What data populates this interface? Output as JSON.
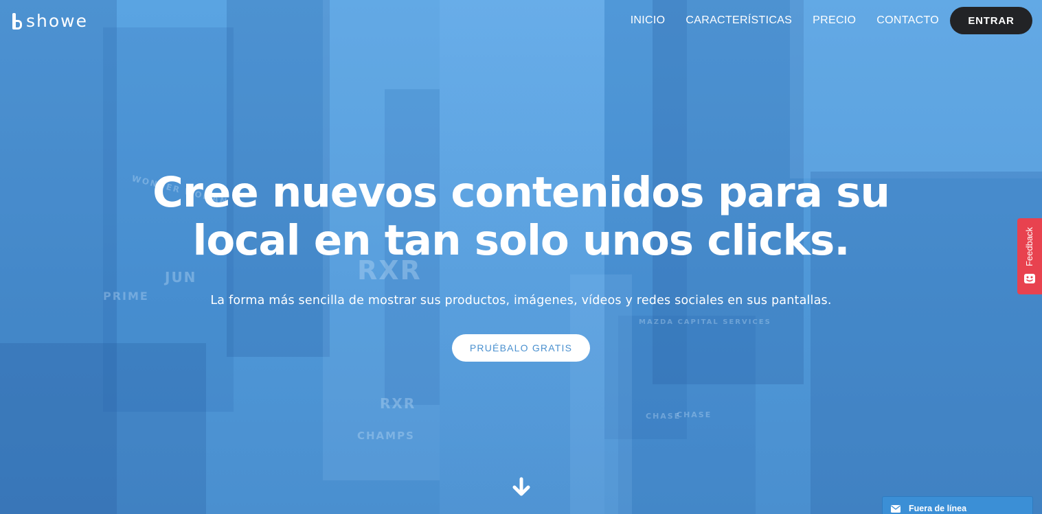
{
  "brand": {
    "name": "showe",
    "logo_icon": "showe-logo-icon"
  },
  "nav": {
    "items": [
      {
        "label": "INICIO"
      },
      {
        "label": "CARACTERÍSTICAS"
      },
      {
        "label": "PRECIO"
      },
      {
        "label": "CONTACTO"
      }
    ],
    "login_label": "ENTRAR"
  },
  "hero": {
    "headline_line1": "Cree nuevos contenidos para su",
    "headline_line2": "local en tan solo unos clicks.",
    "subheadline": "La forma más sencilla de mostrar sus productos, imágenes, vídeos y redes sociales en sus pantallas.",
    "cta_label": "PRUÉBALO GRATIS",
    "scroll_icon": "arrow-down-icon"
  },
  "feedback": {
    "label": "Feedback",
    "icon": "feedback-face-icon"
  },
  "chat": {
    "label": "Fuera de línea",
    "icon": "envelope-icon"
  },
  "colors": {
    "overlay_blue": "#4f98d8",
    "login_button_bg": "#222326",
    "cta_text": "#4a90cf",
    "feedback_bg": "#e8424f",
    "chat_bg": "#3b8fd6"
  },
  "background": {
    "signs": [
      "RXR",
      "RXR",
      "CHAMPS",
      "CHASE",
      "CHASE",
      "MAZDA CAPITAL SERVICES",
      "JUN",
      "WONDER WOMAN",
      "PRIME"
    ]
  }
}
